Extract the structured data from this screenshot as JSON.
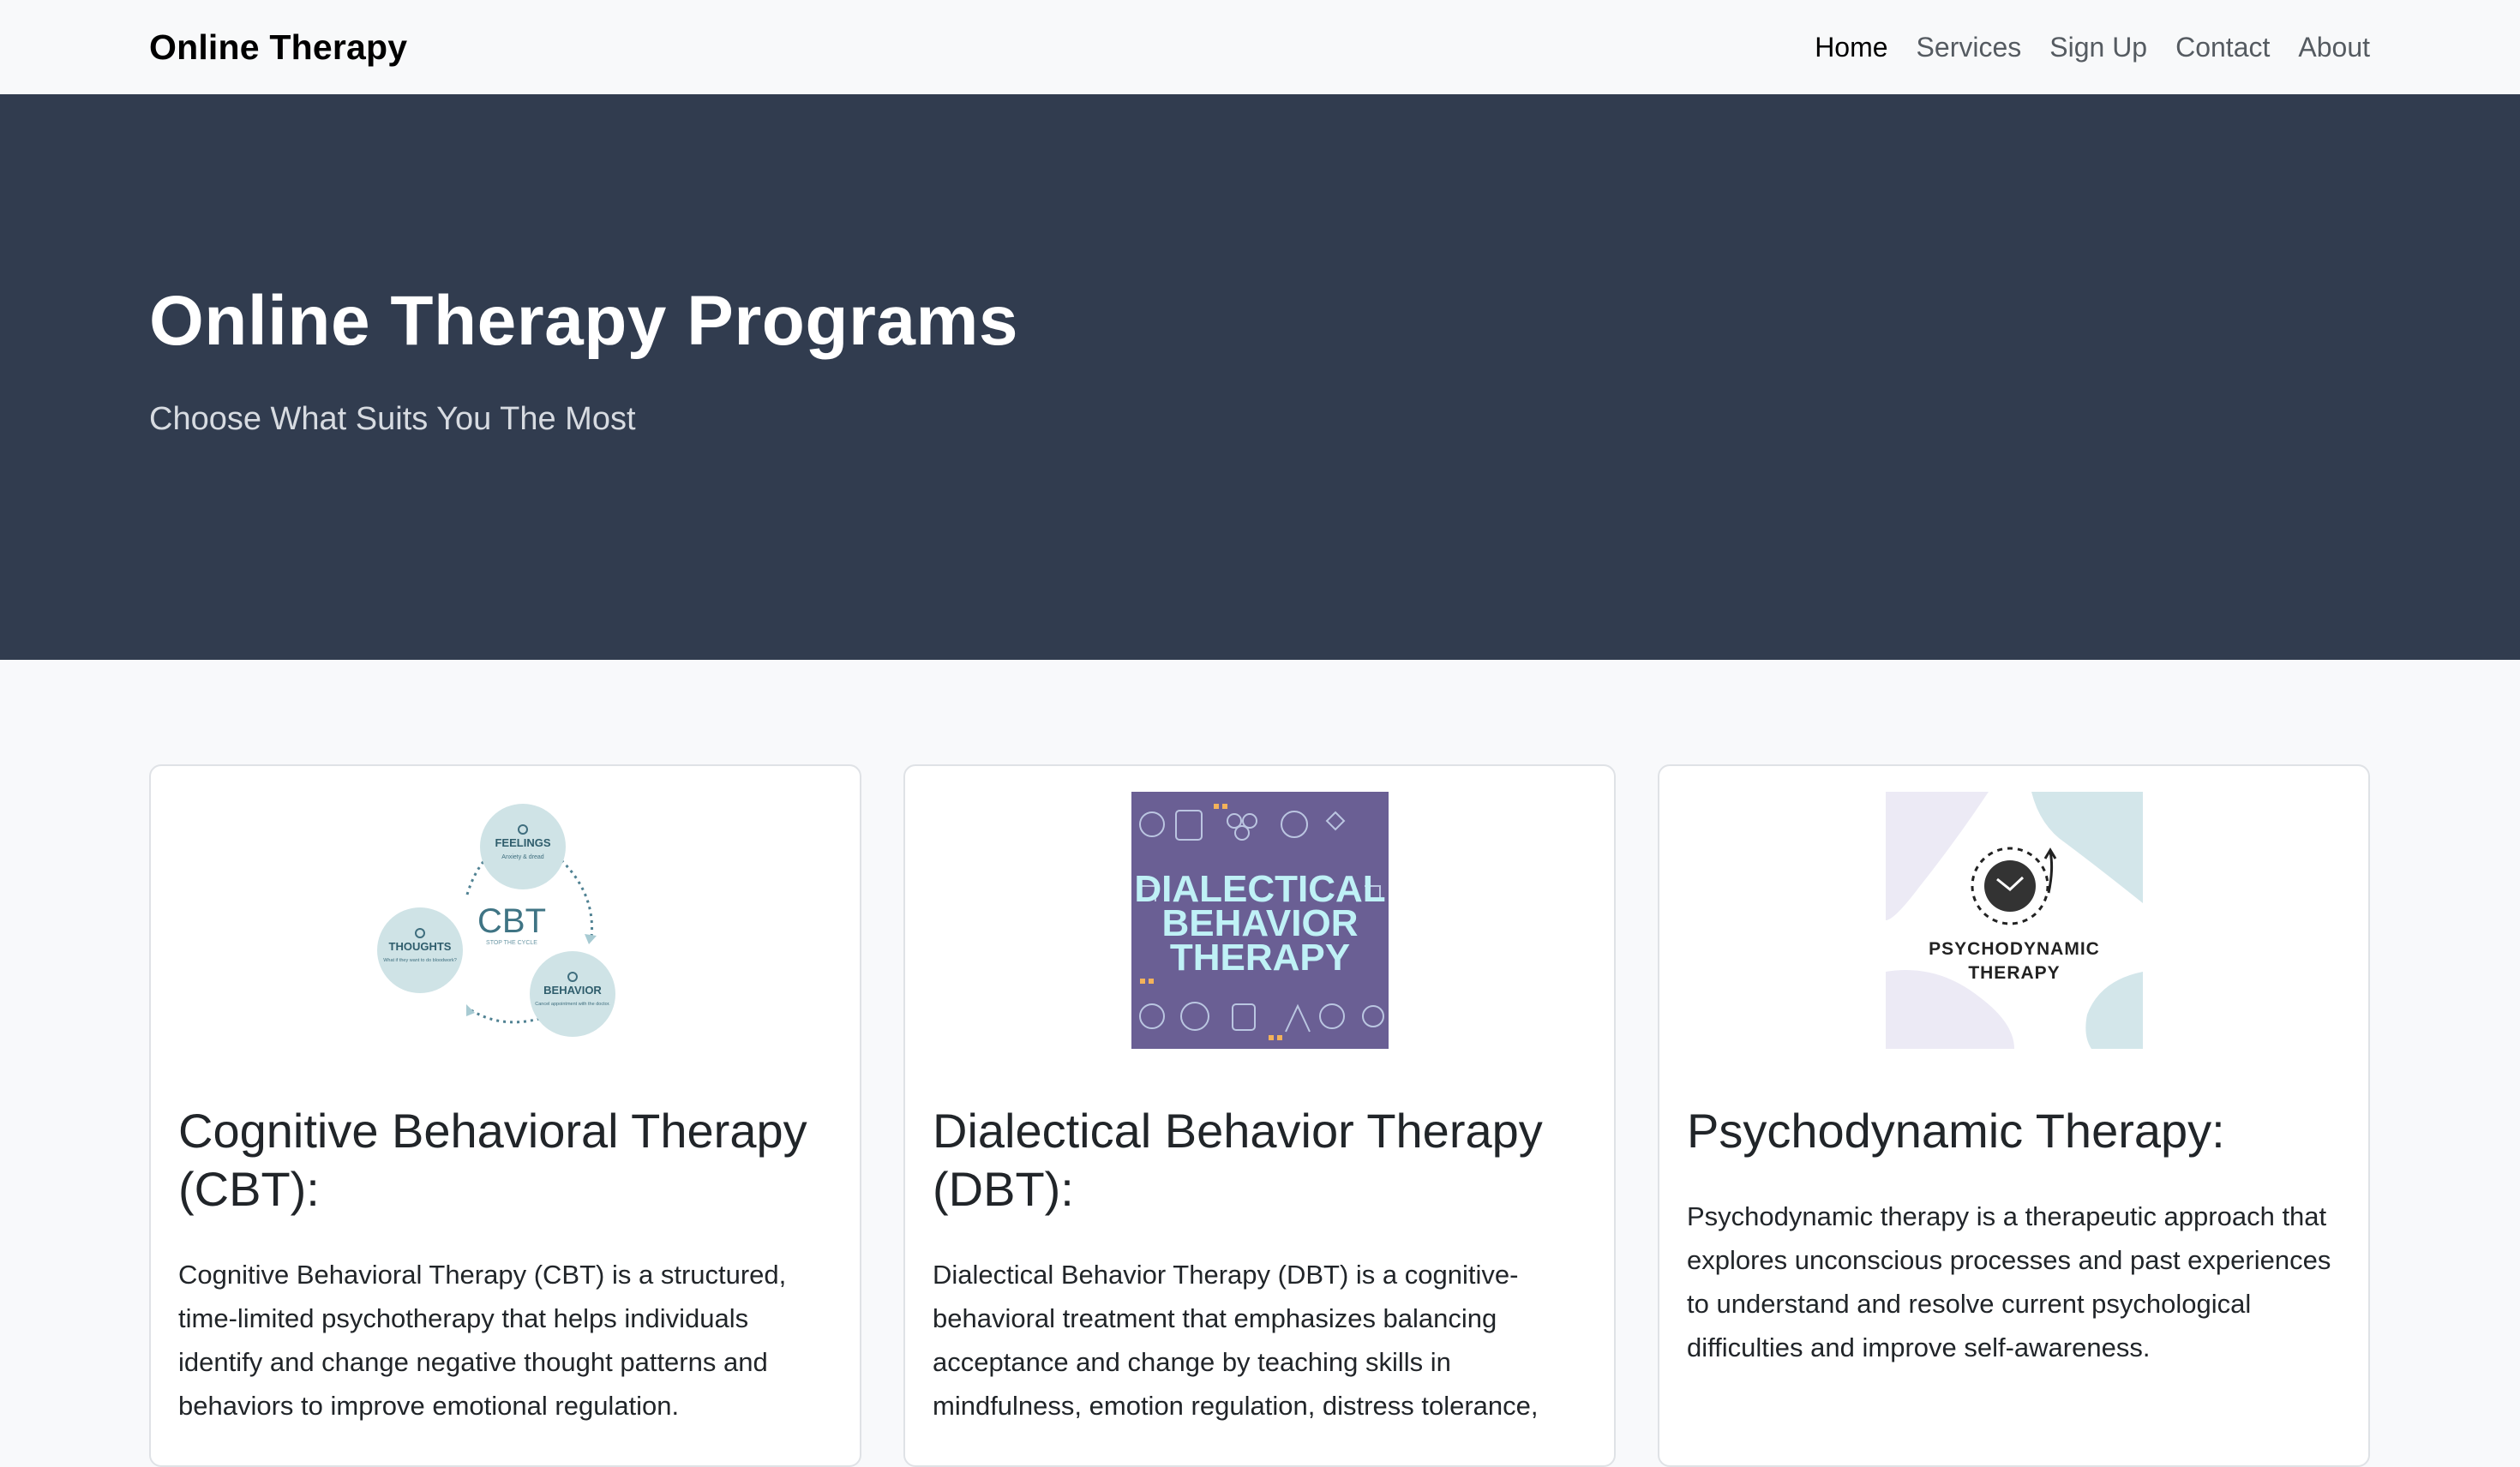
{
  "navbar": {
    "brand": "Online Therapy",
    "links": [
      {
        "label": "Home",
        "active": true
      },
      {
        "label": "Services",
        "active": false
      },
      {
        "label": "Sign Up",
        "active": false
      },
      {
        "label": "Contact",
        "active": false
      },
      {
        "label": "About",
        "active": false
      }
    ]
  },
  "hero": {
    "title": "Online Therapy Programs",
    "subtitle": "Choose What Suits You The Most",
    "background": "#313c4f"
  },
  "cards": [
    {
      "image": {
        "center_label": "CBT",
        "center_sub": "STOP THE CYCLE",
        "nodes": [
          {
            "title": "FEELINGS",
            "sub": "Anxiety & dread"
          },
          {
            "title": "THOUGHTS",
            "sub": "What if they want to do bloodwork?"
          },
          {
            "title": "BEHAVIOR",
            "sub": "Cancel appointment with the doctor."
          }
        ]
      },
      "title": "Cognitive Behavioral Therapy (CBT):",
      "text": "Cognitive Behavioral Therapy (CBT) is a structured, time-limited psychotherapy that helps individuals identify and change negative thought patterns and behaviors to improve emotional regulation."
    },
    {
      "image": {
        "lines": [
          "DIALECTICAL",
          "BEHAVIOR",
          "THERAPY"
        ],
        "background": "#6a5f94",
        "text_color": "#bff1f6"
      },
      "title": "Dialectical Behavior Therapy (DBT):",
      "text": "Dialectical Behavior Therapy (DBT) is a cognitive-behavioral treatment that emphasizes balancing acceptance and change by teaching skills in mindfulness, emotion regulation, distress tolerance,"
    },
    {
      "image": {
        "lines": [
          "PSYCHODYNAMIC",
          "THERAPY"
        ]
      },
      "title": "Psychodynamic Therapy:",
      "text": "Psychodynamic therapy is a therapeutic approach that explores unconscious processes and past experiences to understand and resolve current psychological difficulties and improve self-awareness."
    }
  ]
}
